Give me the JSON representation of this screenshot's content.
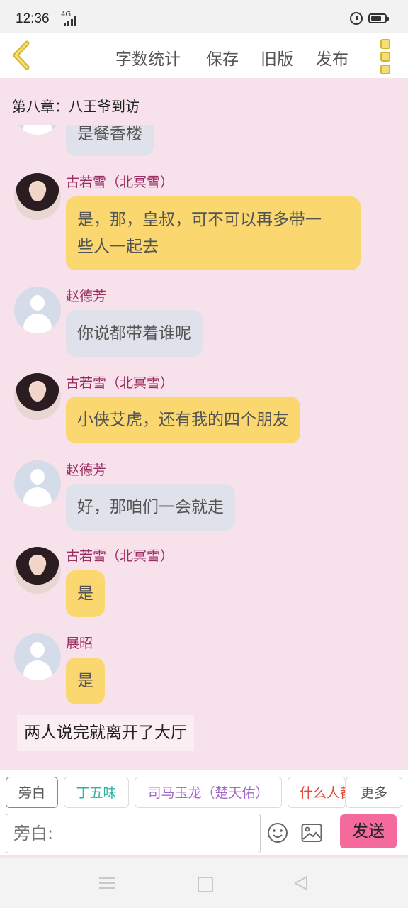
{
  "status": {
    "time": "12:36",
    "network": "4G"
  },
  "topnav": {
    "word_count": "字数统计",
    "save": "保存",
    "old_version": "旧版",
    "publish": "发布"
  },
  "chapter": {
    "title": "第八章：八王爷到访"
  },
  "messages": [
    {
      "speaker": "",
      "text": "是餐香楼",
      "color": "gray"
    },
    {
      "speaker": "古若雪（北冥雪）",
      "lines": [
        "是，那，皇叔，可不可以再多带一",
        "些人一起去"
      ],
      "color": "yellow"
    },
    {
      "speaker": "赵德芳",
      "text": "你说都带着谁呢",
      "color": "gray"
    },
    {
      "speaker": "古若雪（北冥雪）",
      "text": "小侠艾虎，还有我的四个朋友",
      "color": "yellow"
    },
    {
      "speaker": "赵德芳",
      "text": "好，那咱们一会就走",
      "color": "gray"
    },
    {
      "speaker": "古若雪（北冥雪）",
      "text": "是",
      "color": "yellow"
    },
    {
      "speaker": "展昭",
      "text": "是",
      "color": "yellow"
    }
  ],
  "narration": "两人说完就离开了大厅",
  "characters": [
    {
      "label": "旁白",
      "color": "#555555"
    },
    {
      "label": "丁五味",
      "color": "#2bb3a6"
    },
    {
      "label": "司马玉龙（楚天佑）",
      "color": "#a268c8"
    },
    {
      "label": "什么人都",
      "color": "#e04a3a"
    }
  ],
  "more_label": "更多",
  "input": {
    "placeholder": "旁白:"
  },
  "send_label": "发送",
  "colors": {
    "bubble_yellow": "#fad86f",
    "bubble_gray": "#dfe2ea",
    "speaker": "#9b2c62",
    "send": "#f46a9b",
    "background": "#f7e1ea"
  }
}
